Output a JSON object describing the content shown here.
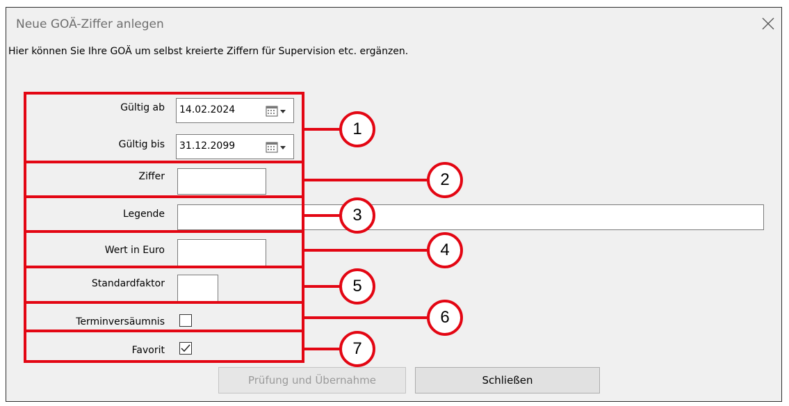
{
  "window": {
    "title": "Neue GOÄ-Ziffer anlegen",
    "description": "Hier können Sie Ihre GOÄ um selbst kreierte Ziffern für Supervision etc. ergänzen."
  },
  "form": {
    "gueltig_ab": {
      "label": "Gültig ab",
      "value": "14.02.2024"
    },
    "gueltig_bis": {
      "label": "Gültig bis",
      "value": "31.12.2099"
    },
    "ziffer": {
      "label": "Ziffer",
      "value": ""
    },
    "legende": {
      "label": "Legende",
      "value": ""
    },
    "wert": {
      "label": "Wert in Euro",
      "value": ""
    },
    "standardfaktor": {
      "label": "Standardfaktor",
      "value": ""
    },
    "terminversaeumnis": {
      "label": "Terminversäumnis",
      "checked": false
    },
    "favorit": {
      "label": "Favorit",
      "checked": true
    }
  },
  "buttons": {
    "pruefung": "Prüfung und Übernahme",
    "schliessen": "Schließen"
  },
  "annotations": [
    "1",
    "2",
    "3",
    "4",
    "5",
    "6",
    "7"
  ],
  "colors": {
    "annotation": "#e30613",
    "dialog_bg": "#f0f0f0"
  }
}
